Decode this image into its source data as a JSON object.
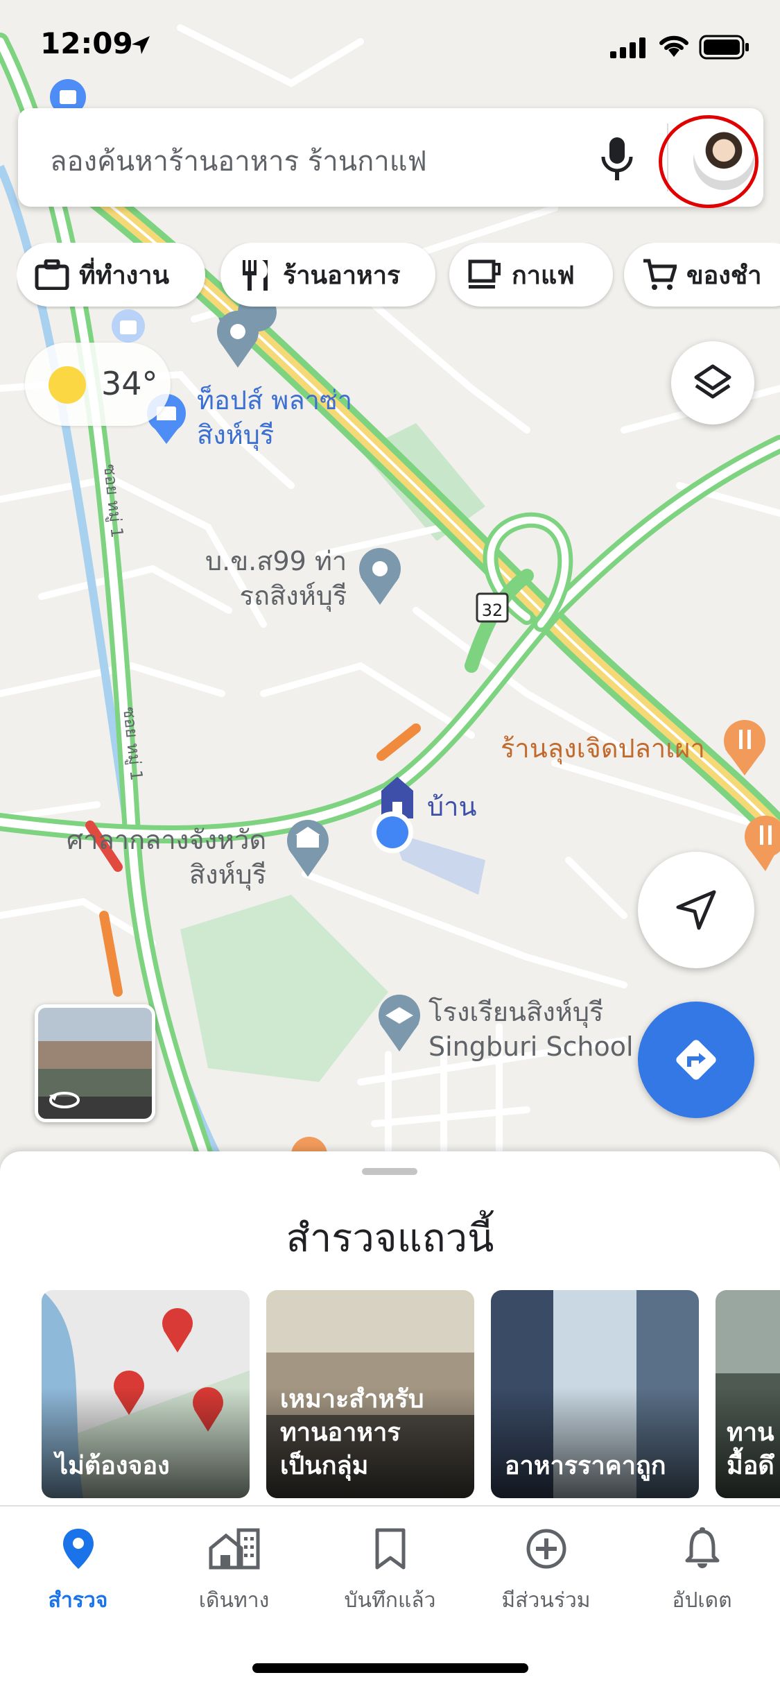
{
  "status_bar": {
    "time": "12:09"
  },
  "search": {
    "placeholder": "ลองค้นหาร้านอาหาร ร้านกาแฟ"
  },
  "chips": [
    {
      "label": "ที่ทำงาน",
      "icon": "briefcase-icon"
    },
    {
      "label": "ร้านอาหาร",
      "icon": "fork-knife-icon"
    },
    {
      "label": "กาแฟ",
      "icon": "coffee-cup-icon"
    },
    {
      "label": "ของชำ",
      "icon": "shopping-cart-icon"
    }
  ],
  "weather": {
    "temperature": "34°"
  },
  "map": {
    "labels": {
      "tops_plaza": "ท็อปส์ พลาซ่า\nสิงห์บุรี",
      "bus_station": "บ.ข.ส99 ท่า\nรถสิงห์บุรี",
      "fish_restaurant": "ร้านลุงเจิดปลาเผา",
      "home": "บ้าน",
      "city_hall": "ศาลากลางจังหวัด\nสิงห์บุรี",
      "school": "โรงเรียนสิงห์บุรี\nSingburi School",
      "road_soi_1": "ซอย หมู่ 1",
      "road_soi_2": "ซอย หมู่ 1",
      "highway": "32"
    }
  },
  "explore": {
    "title": "สำรวจแถวนี้",
    "cards": [
      {
        "caption": "ไม่ต้องจอง"
      },
      {
        "caption": "เหมาะสำหรับ\nทานอาหาร\nเป็นกลุ่ม"
      },
      {
        "caption": "อาหารราคาถูก"
      },
      {
        "caption": "ทาน\nมื้อดึ"
      }
    ]
  },
  "bottom_nav": [
    {
      "label": "สำรวจ",
      "icon": "explore-pin-icon",
      "active": true
    },
    {
      "label": "เดินทาง",
      "icon": "commute-building-icon",
      "active": false
    },
    {
      "label": "บันทึกแล้ว",
      "icon": "bookmark-icon",
      "active": false
    },
    {
      "label": "มีส่วนร่วม",
      "icon": "add-circle-icon",
      "active": false
    },
    {
      "label": "อัปเดต",
      "icon": "bell-icon",
      "active": false
    }
  ],
  "colors": {
    "accent": "#1a73e8",
    "directions_button": "#3478e5",
    "traffic_green": "#7dd37f",
    "highway_yellow": "#f6d977",
    "avatar_ring": "#e00000"
  }
}
